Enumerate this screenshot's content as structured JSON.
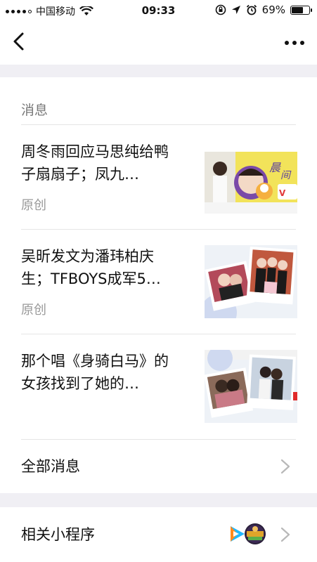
{
  "status": {
    "carrier": "中国移动",
    "time": "09:33",
    "battery_percent": "69%",
    "battery_level": 0.69
  },
  "messages": {
    "section_title": "消息",
    "items": [
      {
        "title": "周冬雨回应马思纯给鸭子扇扇子；凤九…",
        "tag": "原创"
      },
      {
        "title": "吴昕发文为潘玮柏庆生；TFBOYS成军5…",
        "tag": "原创"
      },
      {
        "title": "那个唱《身骑白马》的女孩找到了她的…",
        "tag": ""
      }
    ],
    "all_label": "全部消息"
  },
  "mini_programs": {
    "label": "相关小程序"
  }
}
